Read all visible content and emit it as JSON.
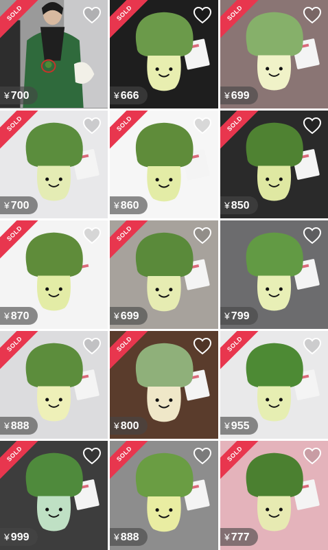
{
  "listings": [
    {
      "sold_label": "SOLD",
      "currency": "¥",
      "price": "700",
      "bg": "#8f8f8f",
      "plush_top": "#3f7a34",
      "plush_face": "#dfe8a8",
      "scene": "person"
    },
    {
      "sold_label": "SOLD",
      "currency": "¥",
      "price": "666",
      "bg": "#1e1e1e",
      "plush_top": "#6b9a4a",
      "plush_face": "#e8eeb0"
    },
    {
      "sold_label": "SOLD",
      "currency": "¥",
      "price": "699",
      "bg": "#8a7574",
      "plush_top": "#86b06a",
      "plush_face": "#f0f2c8"
    },
    {
      "sold_label": "SOLD",
      "currency": "¥",
      "price": "700",
      "bg": "#e8e8ea",
      "plush_top": "#5b8d3d",
      "plush_face": "#e4ecb4"
    },
    {
      "sold_label": "SOLD",
      "currency": "¥",
      "price": "860",
      "bg": "#f6f6f6",
      "plush_top": "#5f8c3a",
      "plush_face": "#e3eca6"
    },
    {
      "sold_label": "SOLD",
      "currency": "¥",
      "price": "850",
      "bg": "#2a2a2a",
      "plush_top": "#4f8232",
      "plush_face": "#dfe8a2"
    },
    {
      "sold_label": "SOLD",
      "currency": "¥",
      "price": "870",
      "bg": "#f4f4f4",
      "plush_top": "#5f8c3a",
      "plush_face": "#e3eca6"
    },
    {
      "sold_label": "SOLD",
      "currency": "¥",
      "price": "699",
      "bg": "#a7a29c",
      "plush_top": "#5a8a3a",
      "plush_face": "#e6ecb2"
    },
    {
      "sold_label": "",
      "currency": "¥",
      "price": "799",
      "bg": "#6c6c6e",
      "plush_top": "#629a44",
      "plush_face": "#e8efb6"
    },
    {
      "sold_label": "SOLD",
      "currency": "¥",
      "price": "888",
      "bg": "#dcdcde",
      "plush_top": "#5c8d3c",
      "plush_face": "#eef0b8"
    },
    {
      "sold_label": "SOLD",
      "currency": "¥",
      "price": "800",
      "bg": "#5a3c2c",
      "plush_top": "#8fb07a",
      "plush_face": "#efe7c8"
    },
    {
      "sold_label": "SOLD",
      "currency": "¥",
      "price": "955",
      "bg": "#e9e9ea",
      "plush_top": "#4d8a34",
      "plush_face": "#e6eeb2"
    },
    {
      "sold_label": "SOLD",
      "currency": "¥",
      "price": "999",
      "bg": "#3d3d3d",
      "plush_top": "#4f8a3c",
      "plush_face": "#bfe0c4"
    },
    {
      "sold_label": "SOLD",
      "currency": "¥",
      "price": "888",
      "bg": "#8d8d8d",
      "plush_top": "#6a9d43",
      "plush_face": "#e9eda2"
    },
    {
      "sold_label": "SOLD",
      "currency": "¥",
      "price": "777",
      "bg": "#e4b3bb",
      "plush_top": "#4b8030",
      "plush_face": "#e7eab2"
    }
  ],
  "accent_sold": "#e8364e",
  "heart_icon": "heart-outline-icon"
}
